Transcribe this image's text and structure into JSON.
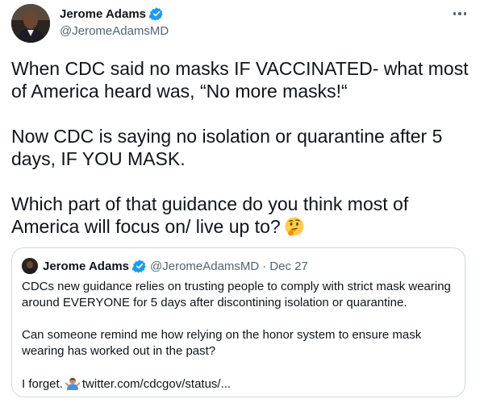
{
  "tweet": {
    "author": {
      "display_name": "Jerome Adams",
      "handle": "@JeromeAdamsMD",
      "verified": true
    },
    "more_icon": "more-horizontal-icon",
    "paragraphs": [
      "When CDC said no masks IF VACCINATED- what most of America heard was, “No more masks!“",
      "Now CDC is saying no isolation or quarantine after 5 days, IF YOU MASK.",
      "Which part of that guidance do you think most of America will focus on/ live up to?"
    ],
    "trailing_emoji": "thinking-face-emoji"
  },
  "quoted_tweet": {
    "author": {
      "display_name": "Jerome Adams",
      "handle": "@JeromeAdamsMD",
      "verified": true
    },
    "separator": "·",
    "date": "Dec 27",
    "paragraphs": [
      "CDCs new guidance relies on trusting people to comply with strict mask wearing around EVERYONE for 5 days after discontining isolation or quarantine.",
      "Can someone remind me how relying on the honor system to ensure mask wearing has worked out in the past?"
    ],
    "final_line": {
      "text": "I forget.",
      "emoji": "man-shrugging-emoji",
      "link": "twitter.com/cdcgov/status/..."
    }
  },
  "colors": {
    "text": "#0f1419",
    "secondary": "#536471",
    "verified_blue": "#1d9bf0",
    "border": "#cfd9de"
  }
}
